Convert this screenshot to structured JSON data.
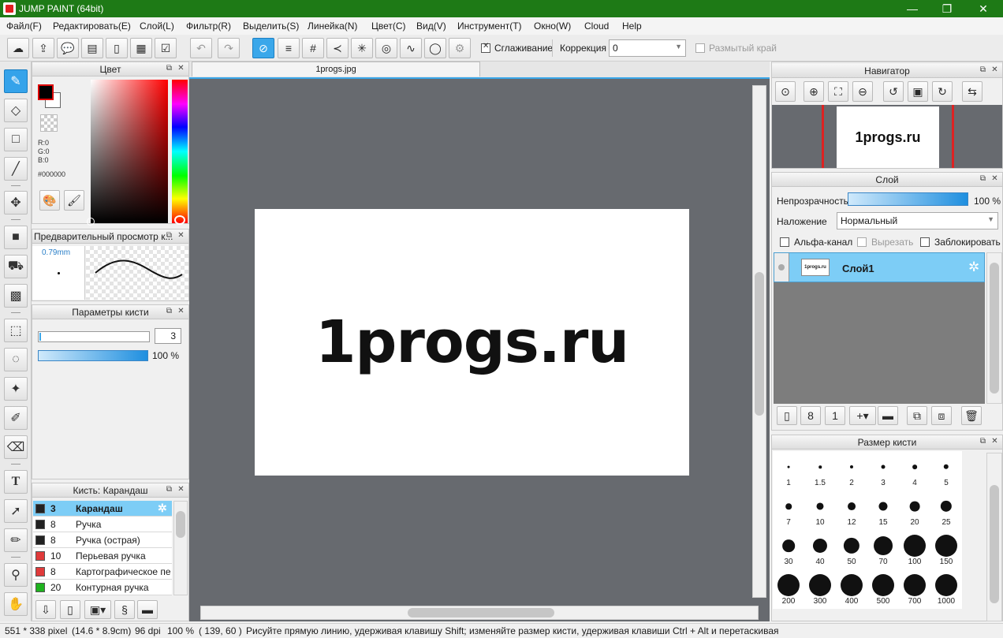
{
  "window": {
    "title": "JUMP PAINT (64bit)",
    "minimize": "—",
    "restore": "❐",
    "close": "✕"
  },
  "menu": [
    "Файл(F)",
    "Редактировать(E)",
    "Слой(L)",
    "Фильтр(R)",
    "Выделить(S)",
    "Линейка(N)",
    "Цвет(C)",
    "Вид(V)",
    "Инструмент(T)",
    "Окно(W)",
    "Cloud",
    "Help"
  ],
  "toolbar": {
    "smoothing_label": "Сглаживание",
    "correction_label": "Коррекция",
    "correction_value": "0",
    "blur_edge_label": "Размытый край"
  },
  "document": {
    "tab": "1progs.jpg",
    "canvas_text": "1progs.ru"
  },
  "color_panel": {
    "title": "Цвет",
    "r": "R:0",
    "g": "G:0",
    "b": "B:0",
    "hex": "#000000",
    "primary": "#000000",
    "secondary": "#ffffff"
  },
  "preview_panel": {
    "title": "Предварительный просмотр к...",
    "size": "0.79mm"
  },
  "brush_params": {
    "title": "Параметры кисти",
    "size_value": "3",
    "opacity_value": "100 %",
    "opacity_fraction": 1.0
  },
  "brush_list": {
    "title": "Кисть: Карандаш",
    "items": [
      {
        "size": "3",
        "name": "Карандаш",
        "color": "#222222",
        "selected": true
      },
      {
        "size": "8",
        "name": "Ручка",
        "color": "#222222"
      },
      {
        "size": "8",
        "name": "Ручка (острая)",
        "color": "#222222"
      },
      {
        "size": "10",
        "name": "Перьевая ручка",
        "color": "#e03a3a"
      },
      {
        "size": "8",
        "name": "Картографическое пе",
        "color": "#e03a3a"
      },
      {
        "size": "20",
        "name": "Контурная ручка",
        "color": "#1fb31f"
      }
    ]
  },
  "navigator": {
    "title": "Навигатор",
    "thumb_text": "1progs.ru"
  },
  "layer_panel": {
    "title": "Слой",
    "opacity_label": "Непрозрачность",
    "opacity_value": "100 %",
    "opacity_fraction": 1.0,
    "blend_label": "Наложение",
    "blend_value": "Нормальный",
    "alpha_label": "Альфа-канал",
    "clip_label": "Вырезать",
    "lock_label": "Заблокировать",
    "layer_name": "Слой1",
    "layer_thumb_text": "1progs.ru"
  },
  "brush_size_panel": {
    "title": "Размер кисти",
    "sizes": [
      "1",
      "1.5",
      "2",
      "3",
      "4",
      "5",
      "7",
      "10",
      "12",
      "15",
      "20",
      "25",
      "30",
      "40",
      "50",
      "70",
      "100",
      "150",
      "200",
      "300",
      "400",
      "500",
      "700",
      "1000"
    ]
  },
  "status": {
    "dimensions": "551 * 338 pixel",
    "physical": "(14.6 * 8.9cm)",
    "dpi": "96 dpi",
    "zoom": "100 %",
    "coords": "( 139, 60 )",
    "hint": "Рисуйте прямую линию, удерживая клавишу Shift; изменяйте размер кисти, удерживая клавиши Ctrl + Alt и перетаскивая"
  }
}
